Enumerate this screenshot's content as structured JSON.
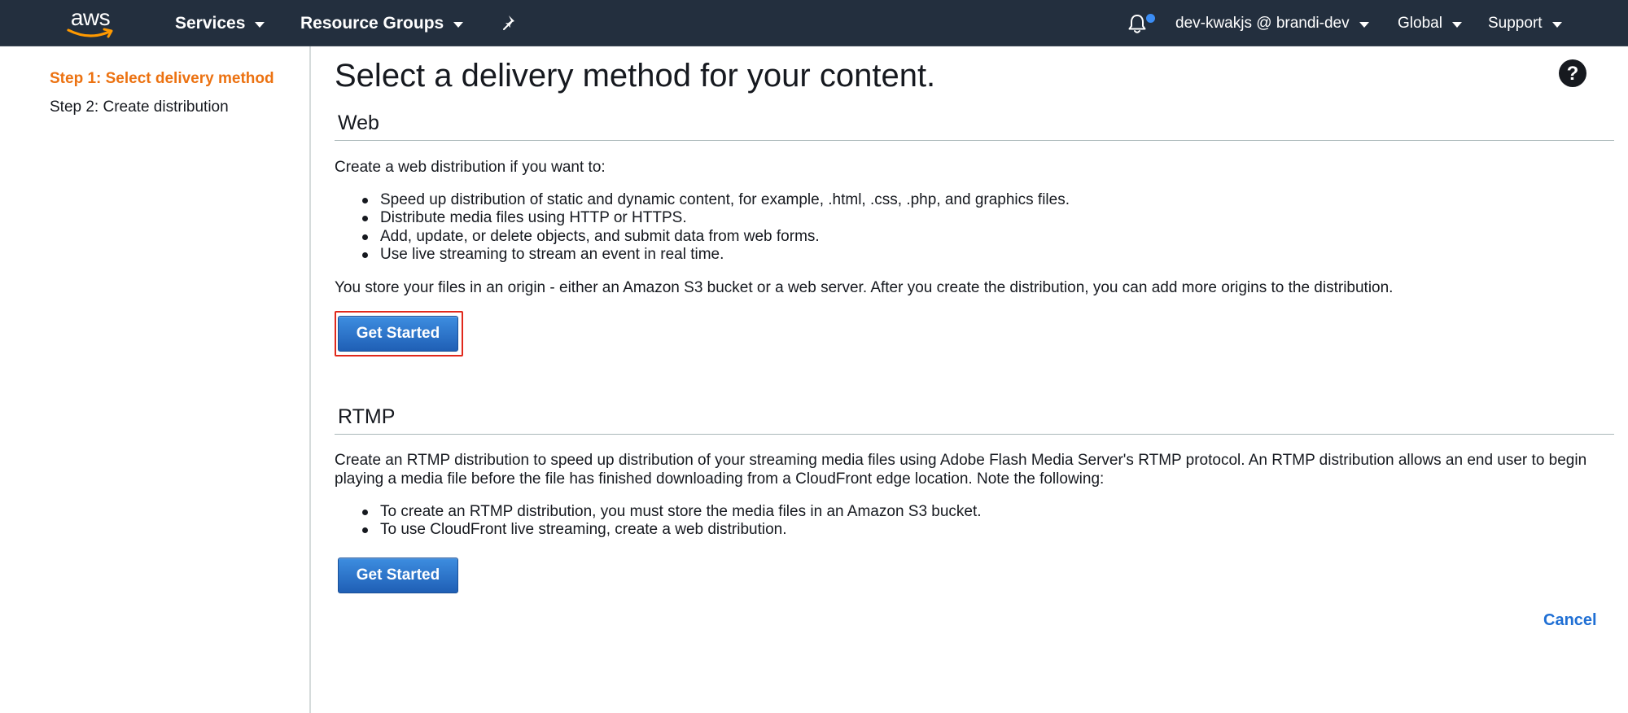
{
  "topnav": {
    "logo_text": "aws",
    "services_label": "Services",
    "resource_groups_label": "Resource Groups",
    "account_label": "dev-kwakjs @ brandi-dev",
    "region_label": "Global",
    "support_label": "Support",
    "accent_color": "#ff9900",
    "notification_dot_color": "#3b8df5"
  },
  "sidebar": {
    "steps": [
      {
        "label": "Step 1: Select delivery method",
        "active": true
      },
      {
        "label": "Step 2: Create distribution",
        "active": false
      }
    ],
    "active_color": "#ec7211"
  },
  "main": {
    "title": "Select a delivery method for your content.",
    "web": {
      "heading": "Web",
      "intro": "Create a web distribution if you want to:",
      "bullets": [
        "Speed up distribution of static and dynamic content, for example, .html, .css, .php, and graphics files.",
        "Distribute media files using HTTP or HTTPS.",
        "Add, update, or delete objects, and submit data from web forms.",
        "Use live streaming to stream an event in real time."
      ],
      "origin_note": "You store your files in an origin - either an Amazon S3 bucket or a web server. After you create the distribution, you can add more origins to the distribution.",
      "button_label": "Get Started"
    },
    "rtmp": {
      "heading": "RTMP",
      "intro": "Create an RTMP distribution to speed up distribution of your streaming media files using Adobe Flash Media Server's RTMP protocol. An RTMP distribution allows an end user to begin playing a media file before the file has finished downloading from a CloudFront edge location. Note the following:",
      "bullets": [
        "To create an RTMP distribution, you must store the media files in an Amazon S3 bucket.",
        "To use CloudFront live streaming, create a web distribution."
      ],
      "button_label": "Get Started"
    },
    "cancel_label": "Cancel"
  },
  "icons": {
    "pin": "pin-icon",
    "bell": "bell-icon",
    "help": "help-icon"
  }
}
